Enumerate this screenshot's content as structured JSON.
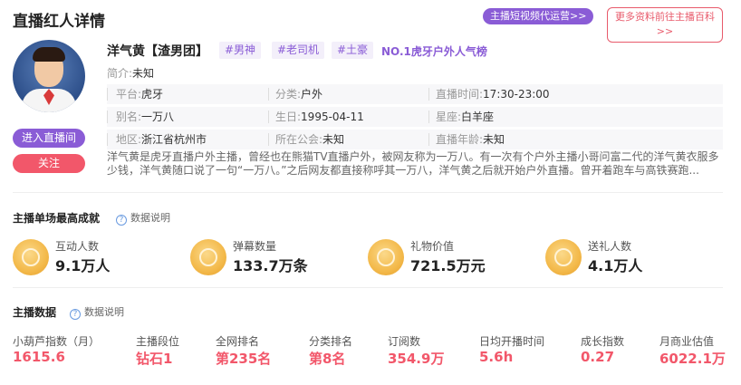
{
  "header": {
    "title": "直播红人详情",
    "agency_button": "主播短视频代运营>>",
    "wiki_button_line1": "更多资料前往主播百科",
    "wiki_button_line2": ">>"
  },
  "profile": {
    "name": "洋气黄【渣男团】",
    "tags": [
      "#男神",
      "#老司机",
      "#土豪"
    ],
    "rank_text": "NO.1虎牙户外人气榜",
    "intro_label": "简介:",
    "intro_value": "未知",
    "live_button": "进入直播间",
    "follow_button": "关注",
    "info_rows": [
      [
        {
          "label": "平台:",
          "value": "虎牙"
        },
        {
          "label": "分类:",
          "value": "户外"
        },
        {
          "label": "直播时间:",
          "value": "17:30-23:00"
        }
      ],
      [
        {
          "label": "别名:",
          "value": "一万八"
        },
        {
          "label": "生日:",
          "value": "1995-04-11"
        },
        {
          "label": "星座:",
          "value": "白羊座"
        }
      ],
      [
        {
          "label": "地区:",
          "value": "浙江省杭州市"
        },
        {
          "label": "所在公会:",
          "value": "未知"
        },
        {
          "label": "直播年龄:",
          "value": "未知"
        }
      ]
    ],
    "description_line1": "洋气黄是虎牙直播户外主播，曾经也在熊猫TV直播户外，被网友称为一万八。有一次有个户外主播小哥问富二代的洋气黄衣服多",
    "description_line2": "少钱，洋气黄随口说了一句“一万八。”之后网友都直接称呼其一万八，洋气黄之后就开始户外直播。曾开着跑车与高铁赛跑..."
  },
  "single_best": {
    "title": "主播单场最高成就",
    "help": "数据说明",
    "stats": [
      {
        "label": "互动人数",
        "value": "9.1万人",
        "icon": "interaction-medal-icon"
      },
      {
        "label": "弹幕数量",
        "value": "133.7万条",
        "icon": "barrage-medal-icon"
      },
      {
        "label": "礼物价值",
        "value": "721.5万元",
        "icon": "gift-medal-icon"
      },
      {
        "label": "送礼人数",
        "value": "4.1万人",
        "icon": "gifter-medal-icon"
      }
    ]
  },
  "anchor_data": {
    "title": "主播数据",
    "help": "数据说明",
    "items": [
      {
        "label": "小葫芦指数（月）",
        "value": "1615.6"
      },
      {
        "label": "主播段位",
        "value": "钻石1"
      },
      {
        "label": "全网排名",
        "value": "第235名"
      },
      {
        "label": "分类排名",
        "value": "第8名"
      },
      {
        "label": "订阅数",
        "value": "354.9万"
      },
      {
        "label": "日均开播时间",
        "value": "5.6h"
      },
      {
        "label": "成长指数",
        "value": "0.27"
      },
      {
        "label": "月商业估值",
        "value": "6022.1万"
      }
    ]
  },
  "colors": {
    "accent_purple": "#8a5cd6",
    "accent_red": "#f2576a",
    "medal_gold": "#f3b94a"
  }
}
